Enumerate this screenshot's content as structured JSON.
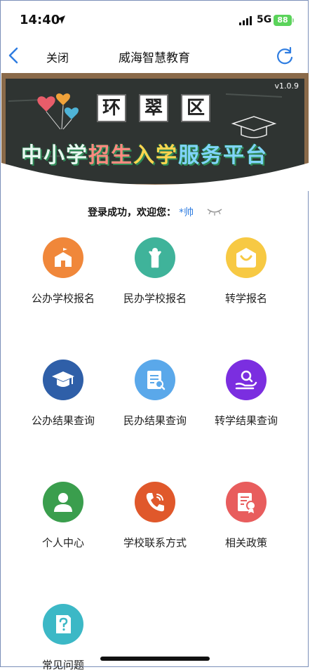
{
  "status": {
    "time": "14:40",
    "network": "5G",
    "battery": "88"
  },
  "nav": {
    "close_label": "关闭",
    "title": "威海智慧教育"
  },
  "banner": {
    "version": "v1.0.9",
    "tiles": [
      "环",
      "翠",
      "区"
    ],
    "headline_parts": [
      "中小学",
      "招生",
      "入学",
      "服务平台"
    ]
  },
  "welcome": {
    "text": "登录成功，欢迎您：",
    "user": "*帅"
  },
  "menu": [
    {
      "label": "公办学校报名",
      "color": "#f0873a",
      "icon": "school-icon"
    },
    {
      "label": "民办学校报名",
      "color": "#3fb39a",
      "icon": "child-icon"
    },
    {
      "label": "转学报名",
      "color": "#f7c943",
      "icon": "smile-bag-icon"
    },
    {
      "label": "公办结果查询",
      "color": "#2f5fa8",
      "icon": "graduation-cap-icon"
    },
    {
      "label": "民办结果查询",
      "color": "#5aa8ea",
      "icon": "document-search-icon"
    },
    {
      "label": "转学结果查询",
      "color": "#7b2ee0",
      "icon": "hand-search-icon"
    },
    {
      "label": "个人中心",
      "color": "#3a9e4d",
      "icon": "user-icon"
    },
    {
      "label": "学校联系方式",
      "color": "#e0582b",
      "icon": "phone-icon"
    },
    {
      "label": "相关政策",
      "color": "#e85d5d",
      "icon": "certificate-icon"
    },
    {
      "label": "常见问题",
      "color": "#3cb8c6",
      "icon": "question-doc-icon"
    }
  ]
}
